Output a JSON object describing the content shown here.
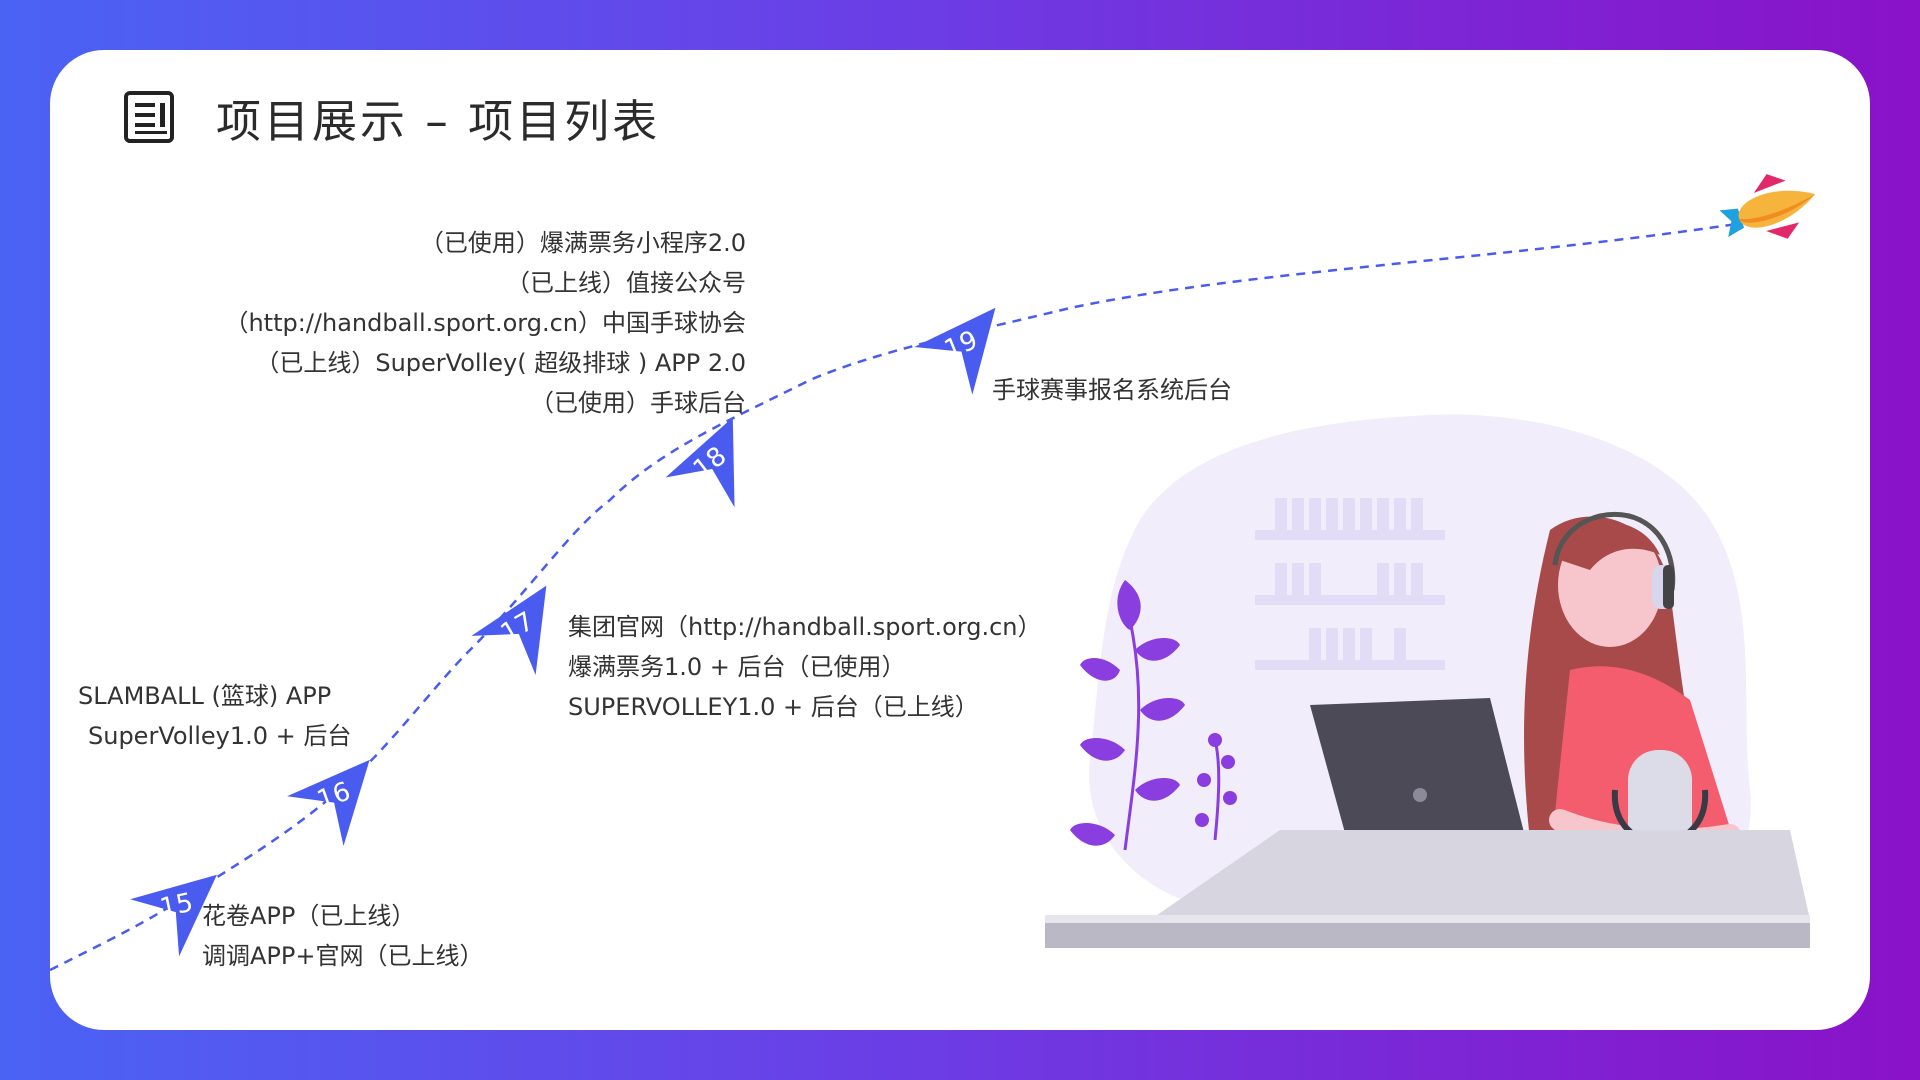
{
  "title": "项目展示 – 项目列表",
  "colors": {
    "accent": "#4a5cf0",
    "purple": "#8a12c8",
    "card": "#ffffff",
    "text": "#333333"
  },
  "icons": [
    "document-icon",
    "rocket-icon"
  ],
  "milestones": [
    {
      "number": "15",
      "lines": [
        "花卷APP（已上线）",
        "调调APP+官网（已上线）"
      ]
    },
    {
      "number": "16",
      "lines": [
        "SLAMBALL (篮球) APP",
        "SuperVolley1.0 + 后台"
      ]
    },
    {
      "number": "17",
      "lines": [
        "集团官网（http://handball.sport.org.cn）",
        "爆满票务1.0 + 后台（已使用）",
        "SUPERVOLLEY1.0 + 后台（已上线）"
      ]
    },
    {
      "number": "18",
      "lines": [
        "（已使用）爆满票务小程序2.0",
        "（已上线）值接公众号",
        "（http://handball.sport.org.cn）中国手球协会",
        "（已上线）SuperVolley( 超级排球 ) APP 2.0",
        "（已使用）手球后台"
      ]
    },
    {
      "number": "19",
      "lines": [
        "手球赛事报名系统后台"
      ]
    }
  ]
}
